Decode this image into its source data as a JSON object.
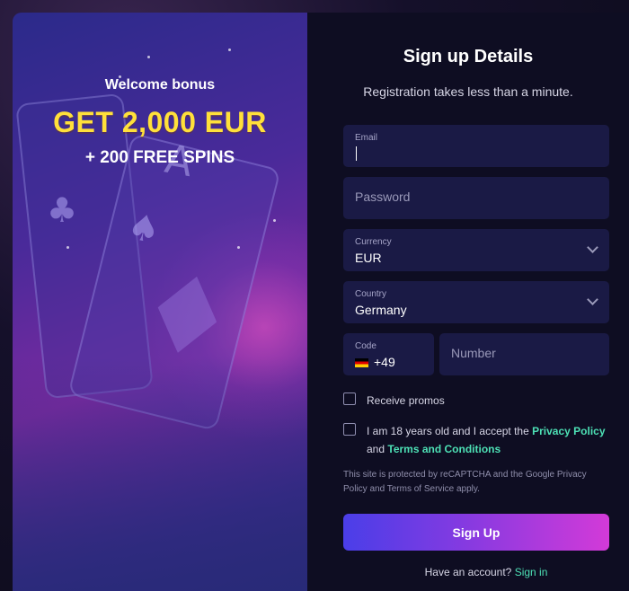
{
  "promo": {
    "welcome": "Welcome bonus",
    "amount": "GET 2,000 EUR",
    "spins": "+ 200 FREE SPINS"
  },
  "form": {
    "title": "Sign up Details",
    "subtitle": "Registration takes less than a minute.",
    "email": {
      "label": "Email",
      "value": ""
    },
    "password": {
      "placeholder": "Password"
    },
    "currency": {
      "label": "Currency",
      "value": "EUR"
    },
    "country": {
      "label": "Country",
      "value": "Germany"
    },
    "code": {
      "label": "Code",
      "value": "+49"
    },
    "number": {
      "placeholder": "Number"
    },
    "promos_label": "Receive promos",
    "terms": {
      "prefix": "I am 18 years old and I accept the",
      "privacy_link": "Privacy Policy",
      "and": "and",
      "terms_link": "Terms and Conditions"
    },
    "recaptcha": "This site is protected by reCAPTCHA and the Google Privacy Policy and Terms of Service apply.",
    "signup_label": "Sign Up",
    "have_account": "Have an account?",
    "signin_link": "Sign in"
  },
  "colors": {
    "accent_yellow": "#ffe03a",
    "link_green": "#4de0b5",
    "field_bg": "#1a1a45",
    "panel_bg": "#0e0d22",
    "button_start": "#4a3ee8",
    "button_end": "#d33ad8"
  }
}
